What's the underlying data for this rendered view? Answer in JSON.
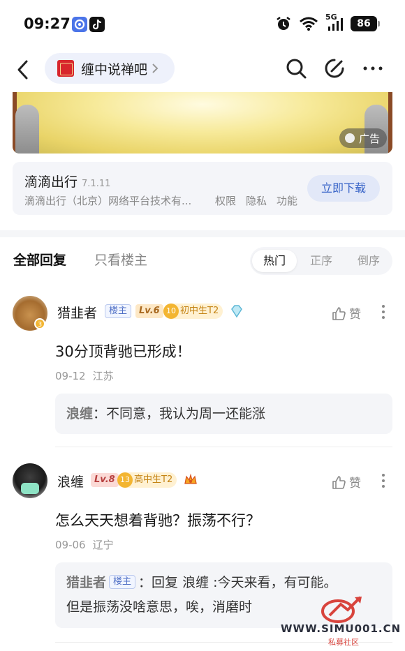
{
  "status_bar": {
    "time": "09:27",
    "network": "5G",
    "battery": "86",
    "icons": [
      "app-notification-icon",
      "tiktok-icon",
      "alarm-icon",
      "wifi-icon",
      "signal-icon",
      "battery-icon"
    ]
  },
  "nav": {
    "forum_name": "缠中说禅吧",
    "icons": [
      "back-icon",
      "search-icon",
      "edit-icon",
      "more-icon"
    ]
  },
  "ad": {
    "badge_label": "广告",
    "app_name": "滴滴出行",
    "version": "7.1.11",
    "developer": "滴滴出行（北京）网络平台技术有...",
    "links": [
      "权限",
      "隐私",
      "功能"
    ],
    "download_label": "立即下载"
  },
  "tabs": {
    "all_replies": "全部回复",
    "op_only": "只看楼主",
    "sort": [
      "热门",
      "正序",
      "倒序"
    ],
    "active_sort": "热门"
  },
  "comments": [
    {
      "username": "猎韭者",
      "op_badge": "楼主",
      "level": "Lv.6",
      "grade_number": "10",
      "grade_label": "初中生T2",
      "avatar_level": "3",
      "like_label": "赞",
      "text": "30分顶背驰已形成！",
      "date": "09-12",
      "location": "江苏",
      "reply": {
        "name": "浪缠",
        "separator": "：",
        "text": "不同意，我认为周一还能涨"
      }
    },
    {
      "username": "浪缠",
      "level": "Lv.8",
      "grade_number": "13",
      "grade_label": "高中生T2",
      "like_label": "赞",
      "text": "怎么天天想着背驰？振荡不行？",
      "date": "09-06",
      "location": "辽宁",
      "reply": {
        "name": "猎韭者",
        "op_badge": "楼主",
        "separator": "：",
        "line1": "回复 浪缠 :今天来看，有可能。",
        "line2": "但是振荡没啥意思，唉，消磨时"
      }
    }
  ],
  "watermark": {
    "url": "WWW.SIMU001.CN",
    "subtitle": "私募社区"
  },
  "colors": {
    "accent_blue": "#3662c7",
    "op_badge_blue": "#4f6fc5",
    "grade_gold": "#f3b531",
    "text_gray": "#999999"
  }
}
